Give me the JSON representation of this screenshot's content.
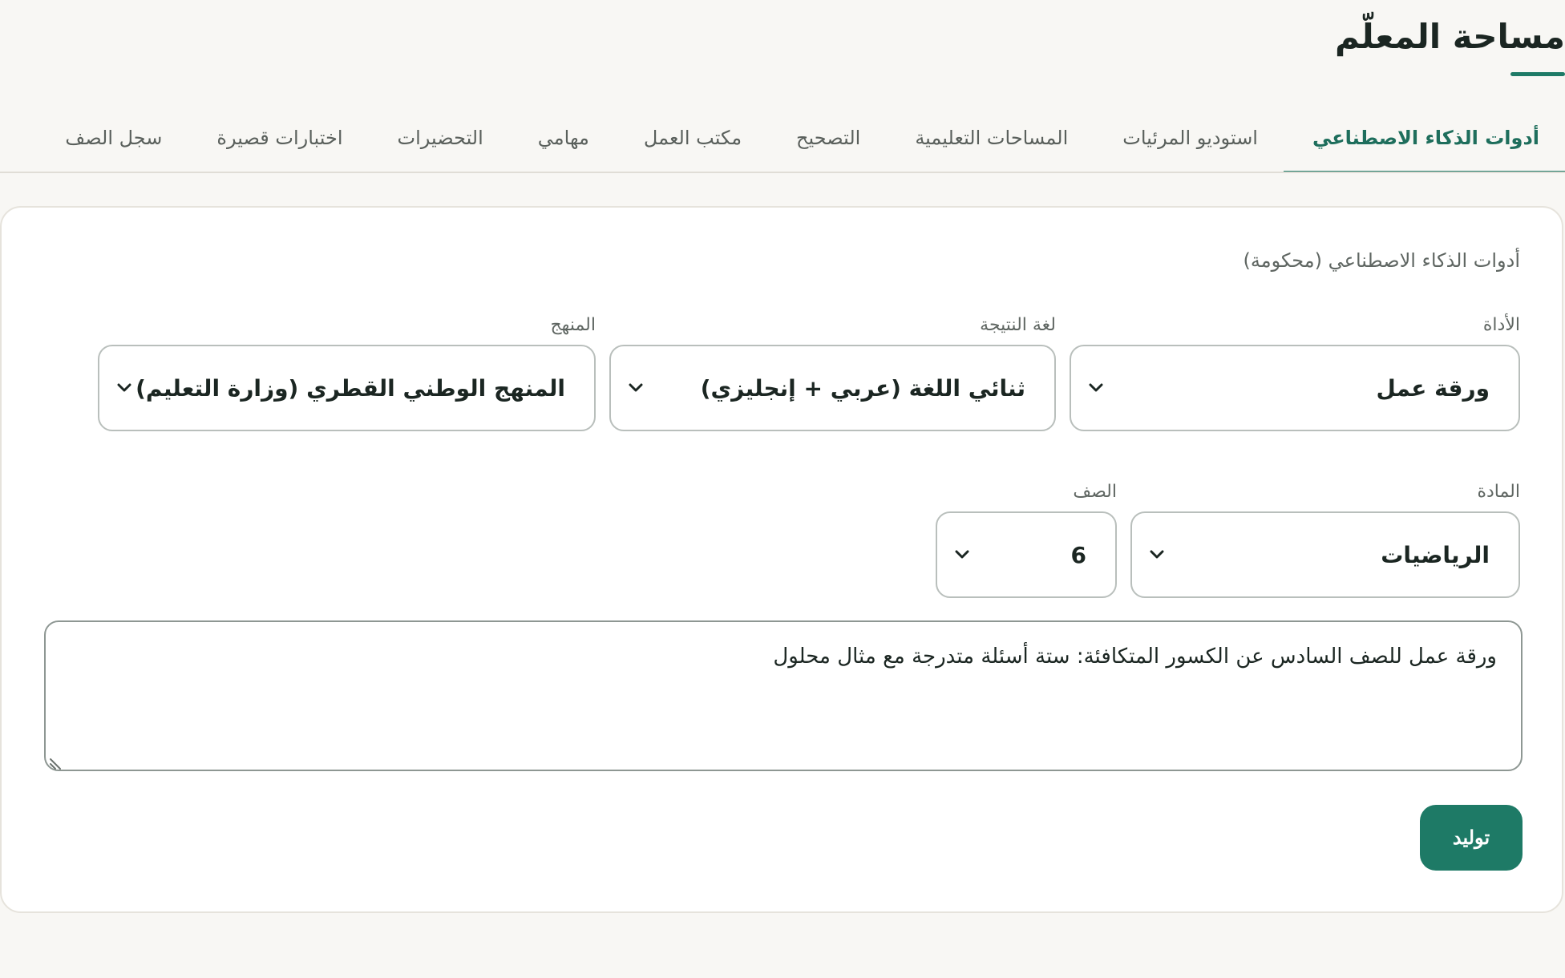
{
  "header": {
    "title": "مساحة المعلّم"
  },
  "tabs": [
    {
      "label": "أدوات الذكاء الاصطناعي",
      "active": true
    },
    {
      "label": "استوديو المرئيات",
      "active": false
    },
    {
      "label": "المساحات التعليمية",
      "active": false
    },
    {
      "label": "التصحيح",
      "active": false
    },
    {
      "label": "مكتب العمل",
      "active": false
    },
    {
      "label": "مهامي",
      "active": false
    },
    {
      "label": "التحضيرات",
      "active": false
    },
    {
      "label": "اختبارات قصيرة",
      "active": false
    },
    {
      "label": "سجل الصف",
      "active": false
    }
  ],
  "panel": {
    "section_label": "أدوات الذكاء الاصطناعي (محكومة)",
    "tool": {
      "label": "الأداة",
      "value": "ورقة عمل"
    },
    "output_language": {
      "label": "لغة النتيجة",
      "value": "ثنائي اللغة (عربي + إنجليزي)"
    },
    "curriculum": {
      "label": "المنهج",
      "value": "المنهج الوطني القطري (وزارة التعليم)"
    },
    "subject": {
      "label": "المادة",
      "value": "الرياضيات"
    },
    "grade": {
      "label": "الصف",
      "value": "6"
    },
    "prompt": {
      "value": "ورقة عمل للصف السادس عن الكسور المتكافئة: ستة أسئلة متدرجة مع مثال محلول"
    },
    "generate_label": "توليد"
  },
  "colors": {
    "accent": "#1e7a66",
    "background": "#f8f7f4",
    "card": "#ffffff"
  }
}
